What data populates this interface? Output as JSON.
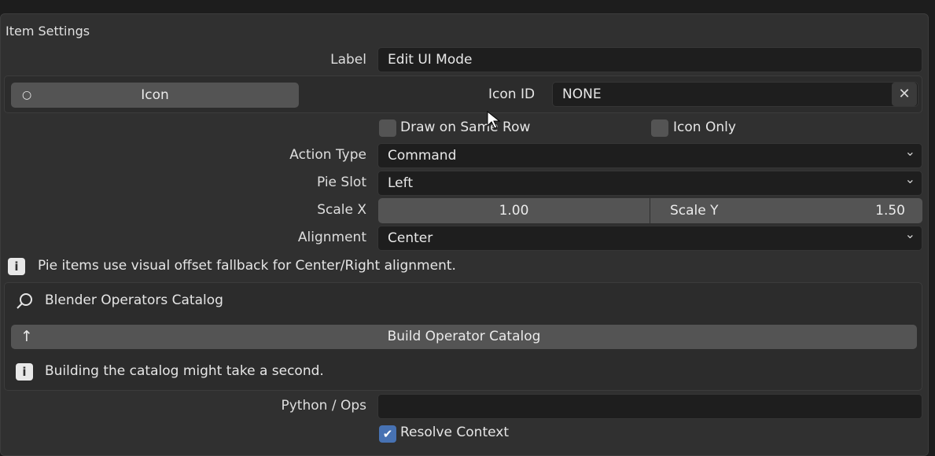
{
  "section": {
    "title": "Item Settings"
  },
  "label_row": {
    "label": "Label",
    "value": "Edit UI Mode"
  },
  "icon_row": {
    "icon_button": "Icon",
    "icon_id_label": "Icon ID",
    "icon_id_value": "NONE"
  },
  "checkboxes": {
    "same_row": {
      "label": "Draw on Same Row",
      "checked": false
    },
    "icon_only": {
      "label": "Icon Only",
      "checked": false
    }
  },
  "action_type": {
    "label": "Action Type",
    "value": "Command"
  },
  "pie_slot": {
    "label": "Pie Slot",
    "value": "Left"
  },
  "scale": {
    "x_label": "Scale X",
    "x_value": "1.00",
    "y_label": "Scale Y",
    "y_value": "1.50"
  },
  "alignment": {
    "label": "Alignment",
    "value": "Center"
  },
  "pie_info": "Pie items use visual offset fallback for Center/Right alignment.",
  "catalog": {
    "title": "Blender Operators Catalog",
    "build_button": "Build Operator Catalog",
    "info": "Building the catalog might take a second."
  },
  "python_ops": {
    "label": "Python / Ops",
    "value": ""
  },
  "resolve_context": {
    "label": "Resolve Context",
    "checked": true
  }
}
